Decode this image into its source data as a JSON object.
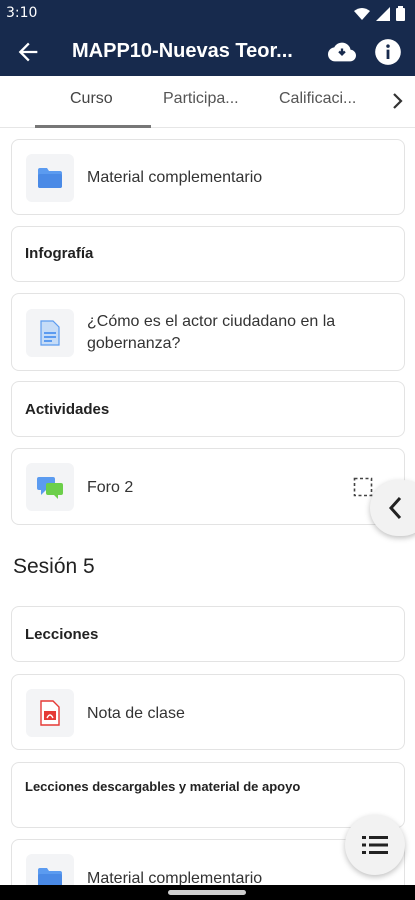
{
  "status_bar": {
    "time": "3:10"
  },
  "app_bar": {
    "title": "MAPP10-Nuevas Teor..."
  },
  "tabs": [
    {
      "label": "Curso",
      "active": true
    },
    {
      "label": "Participa..."
    },
    {
      "label": "Calificaci..."
    }
  ],
  "items": {
    "material_1": "Material complementario",
    "infografia_heading": "Infografía",
    "infografia_item": "¿Cómo es el actor ciudadano en la gobernanza?",
    "actividades_heading": "Actividades",
    "foro": "Foro 2",
    "section": "Sesión 5",
    "lecciones_heading": "Lecciones",
    "nota": "Nota de clase",
    "descargables_heading": "Lecciones descargables y material de apoyo",
    "material_2": "Material complementario"
  },
  "icons": {
    "back": "arrow-left-icon",
    "download": "cloud-download-icon",
    "info": "info-icon",
    "folder": "folder-icon",
    "page": "page-icon",
    "forum": "forum-icon",
    "pdf": "pdf-icon",
    "checkbox": "completion-checkbox-icon",
    "drawer": "chevron-left-icon",
    "index": "list-icon"
  },
  "colors": {
    "app_bar": "#172a4d",
    "folder": "#5b9bf0",
    "pdf": "#e53935"
  }
}
